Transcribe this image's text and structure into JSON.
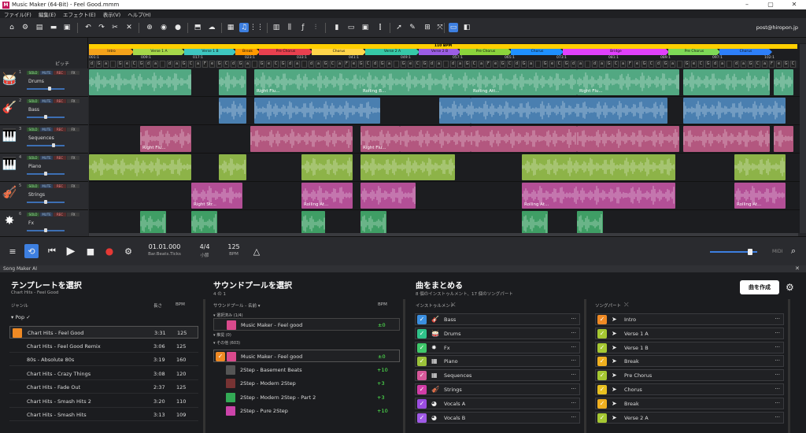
{
  "window": {
    "title": "Music Maker (64-Bit) - Feel Good.mmm",
    "logo": "M",
    "user_email": "post@hiropon.jp"
  },
  "menu": [
    "ファイル(F)",
    "編集(E)",
    "エフェクト(E)",
    "表示(V)",
    "ヘルプ(H)"
  ],
  "toolbar_icons": [
    "home-icon",
    "gear-icon",
    "new-file-icon",
    "open-folder-icon",
    "save-icon",
    "undo-icon",
    "redo-icon",
    "cut-icon",
    "close-icon",
    "add-icon",
    "record-icon",
    "export-icon",
    "upload-icon",
    "arrange-view-icon",
    "note-view-icon",
    "grid-view-icon",
    "piano-icon",
    "mixer-icon",
    "eq-icon",
    "meter-icon",
    "display-icon",
    "snap-icon",
    "pointer-icon",
    "draw-icon",
    "screen-icon",
    "panel-icon"
  ],
  "ruler": {
    "tempo_label": "110 BPM",
    "pitch_label": "ピッチ",
    "bar_labels": [
      "001:1",
      "009:1",
      "017:1",
      "023:1",
      "033:1",
      "041:1",
      "049:1",
      "057:1",
      "065:1",
      "073:1",
      "081:1",
      "089:1",
      "097:1",
      "102:1"
    ],
    "parts": [
      {
        "label": "Intro",
        "color": "#f5a31a",
        "w": 57
      },
      {
        "label": "Verse 1 A",
        "color": "#a6d84a",
        "w": 66
      },
      {
        "label": "Verse 1 B",
        "color": "#3ec7c0",
        "w": 66
      },
      {
        "label": "Break",
        "color": "#ff9900",
        "w": 31
      },
      {
        "label": "Pre Chorus",
        "color": "#e8404f",
        "w": 68
      },
      {
        "label": "Chorus",
        "color": "#ffd54a",
        "w": 69
      },
      {
        "label": "Verse 2 A",
        "color": "#36c9a8",
        "w": 69
      },
      {
        "label": "Verse 2 B",
        "color": "#9b5de5",
        "w": 53
      },
      {
        "label": "Pre Chorus",
        "color": "#8bd43c",
        "w": 66
      },
      {
        "label": "Chorus",
        "color": "#1e90ff",
        "w": 67
      },
      {
        "label": "Bridge",
        "color": "#e040fb",
        "w": 135
      },
      {
        "label": "Pre Chorus",
        "color": "#7ed957",
        "w": 66
      },
      {
        "label": "Chorus",
        "color": "#2d7ff9",
        "w": 67
      }
    ],
    "chords": [
      "d",
      "G",
      "a",
      "a|G",
      "G",
      "e",
      "C",
      "G",
      "d",
      "a",
      "a|G",
      "d",
      "a",
      "G",
      "C",
      "a",
      "F",
      "e",
      "G",
      "C"
    ]
  },
  "tracks": [
    {
      "num": "1",
      "name": "Drums",
      "icon": "drums-icon",
      "glyph": "🥁",
      "vol": 0.62,
      "color": "#52a882",
      "clips": [
        [
          0,
          130,
          ""
        ],
        [
          165,
          35,
          ""
        ],
        [
          210,
          325,
          "Right Flu..."
        ],
        [
          345,
          50,
          "Rolling B..."
        ],
        [
          395,
          90,
          ""
        ],
        [
          485,
          135,
          "Rolling Att..."
        ],
        [
          620,
          130,
          "Right Flu..."
        ],
        [
          755,
          110,
          ""
        ],
        [
          870,
          25,
          ""
        ]
      ]
    },
    {
      "num": "2",
      "name": "Bass",
      "icon": "guitar-icon",
      "glyph": "🎸",
      "vol": 0.5,
      "color": "#4a7fb0",
      "clips": [
        [
          165,
          35,
          ""
        ],
        [
          210,
          160,
          ""
        ],
        [
          445,
          40,
          ""
        ],
        [
          485,
          250,
          ""
        ],
        [
          755,
          130,
          ""
        ]
      ]
    },
    {
      "num": "3",
      "name": "Sequences",
      "icon": "keyboard-icon",
      "glyph": "🎹",
      "vol": 0.72,
      "color": "#b3577f",
      "clips": [
        [
          65,
          65,
          "Right Flu..."
        ],
        [
          205,
          130,
          ""
        ],
        [
          345,
          50,
          "Right Flu..."
        ],
        [
          395,
          90,
          ""
        ],
        [
          485,
          135,
          ""
        ],
        [
          620,
          130,
          ""
        ],
        [
          755,
          110,
          ""
        ],
        [
          870,
          25,
          ""
        ]
      ]
    },
    {
      "num": "4",
      "name": "Piano",
      "icon": "piano-icon",
      "glyph": "🎹",
      "vol": 0.5,
      "color": "#8db348",
      "clips": [
        [
          0,
          130,
          ""
        ],
        [
          165,
          35,
          ""
        ],
        [
          270,
          65,
          ""
        ],
        [
          345,
          120,
          ""
        ],
        [
          550,
          195,
          ""
        ],
        [
          820,
          65,
          ""
        ]
      ]
    },
    {
      "num": "5",
      "name": "Strings",
      "icon": "violin-icon",
      "glyph": "🎻",
      "vol": 0.5,
      "color": "#b34f96",
      "clips": [
        [
          130,
          65,
          "Right Str..."
        ],
        [
          270,
          65,
          "Rolling At..."
        ],
        [
          345,
          70,
          ""
        ],
        [
          550,
          195,
          "Rolling At..."
        ],
        [
          820,
          65,
          "Rolling At..."
        ]
      ]
    },
    {
      "num": "6",
      "name": "Fx",
      "icon": "fx-icon",
      "glyph": "✸",
      "vol": 0.5,
      "color": "#3f9e65",
      "clips": [
        [
          65,
          33,
          ""
        ],
        [
          130,
          33,
          ""
        ],
        [
          270,
          30,
          ""
        ],
        [
          345,
          33,
          ""
        ],
        [
          550,
          33,
          ""
        ],
        [
          620,
          33,
          ""
        ]
      ]
    }
  ],
  "transport": {
    "position": "01.01.000",
    "position_label": "Bar.Beats.Ticks",
    "signature": "4/4",
    "signature_label": "小節",
    "tempo": "125",
    "tempo_label": "BPM",
    "midi_label": "MIDI"
  },
  "song_maker": {
    "panel_title": "Song Maker AI",
    "template": {
      "heading": "テンプレートを選択",
      "subtitle": "Chart Hits - Feel Good",
      "col_genre": "ジャンル",
      "col_length": "長さ",
      "col_bpm": "BPM",
      "group": "Pop ✓",
      "rows": [
        {
          "name": "Chart Hits - Feel Good",
          "len": "3:31",
          "bpm": "125",
          "selected": true,
          "color": "#f08a24"
        },
        {
          "name": "Chart Hits - Feel Good Remix",
          "len": "3:06",
          "bpm": "125"
        },
        {
          "name": "80s - Absolute 80s",
          "len": "3:19",
          "bpm": "160"
        },
        {
          "name": "Chart Hits - Crazy Things",
          "len": "3:08",
          "bpm": "120"
        },
        {
          "name": "Chart Hits - Fade Out",
          "len": "2:37",
          "bpm": "125"
        },
        {
          "name": "Chart Hits - Smash Hits 2",
          "len": "3:20",
          "bpm": "110"
        },
        {
          "name": "Chart Hits - Smash Hits",
          "len": "3:13",
          "bpm": "109"
        }
      ]
    },
    "soundpool": {
      "heading": "サウンドプールを選択",
      "subtitle": "4 の 1",
      "col_name": "サウンドプール - 名前 ▾",
      "col_bpm": "BPM",
      "sec_selected": "▾ 選択済み (1/4)",
      "sec_recommended": "▾ 推奨 (0)",
      "sec_others": "▾ その他 (603)",
      "selected_row": {
        "name": "Music Maker - Feel good",
        "bpm": "±0"
      },
      "rows": [
        {
          "name": "Music Maker - Feel good",
          "bpm": "±0",
          "checked": true,
          "color": "#d94a8c"
        },
        {
          "name": "2Step - Basement Beats",
          "bpm": "+10",
          "color": "#555"
        },
        {
          "name": "2Step - Modern 2Step",
          "bpm": "+3",
          "color": "#733"
        },
        {
          "name": "2Step - Modern 2Step - Part 2",
          "bpm": "+3",
          "color": "#3a5"
        },
        {
          "name": "2Step - Pure 2Step",
          "bpm": "+10",
          "color": "#c4a"
        }
      ]
    },
    "summary": {
      "heading": "曲をまとめる",
      "subtitle": "8 個のインストゥルメント、17 個のソングパート",
      "create_button": "曲を作成",
      "instruments_label": "インストゥルメント",
      "songparts_label": "ソングパート",
      "instruments": [
        {
          "name": "Bass",
          "color": "#3b8fe0",
          "glyph": "🎸"
        },
        {
          "name": "Drums",
          "color": "#2fc28a",
          "glyph": "🥁"
        },
        {
          "name": "Fx",
          "color": "#3fc86a",
          "glyph": "✸"
        },
        {
          "name": "Piano",
          "color": "#9bc23a",
          "glyph": "▦"
        },
        {
          "name": "Sequences",
          "color": "#d7589a",
          "glyph": "▦"
        },
        {
          "name": "Strings",
          "color": "#d13da6",
          "glyph": "🎻"
        },
        {
          "name": "Vocals A",
          "color": "#9b4de0",
          "glyph": "◕"
        },
        {
          "name": "Vocals B",
          "color": "#a05ae6",
          "glyph": "◕"
        }
      ],
      "songparts": [
        {
          "name": "Intro",
          "color": "#f08a24"
        },
        {
          "name": "Verse 1 A",
          "color": "#a6c832"
        },
        {
          "name": "Verse 1 B",
          "color": "#a6c832"
        },
        {
          "name": "Break",
          "color": "#f0b020"
        },
        {
          "name": "Pre Chorus",
          "color": "#a6c832"
        },
        {
          "name": "Chorus",
          "color": "#e8c020"
        },
        {
          "name": "Break",
          "color": "#f0b020"
        },
        {
          "name": "Verse 2 A",
          "color": "#a6c832"
        }
      ]
    }
  }
}
